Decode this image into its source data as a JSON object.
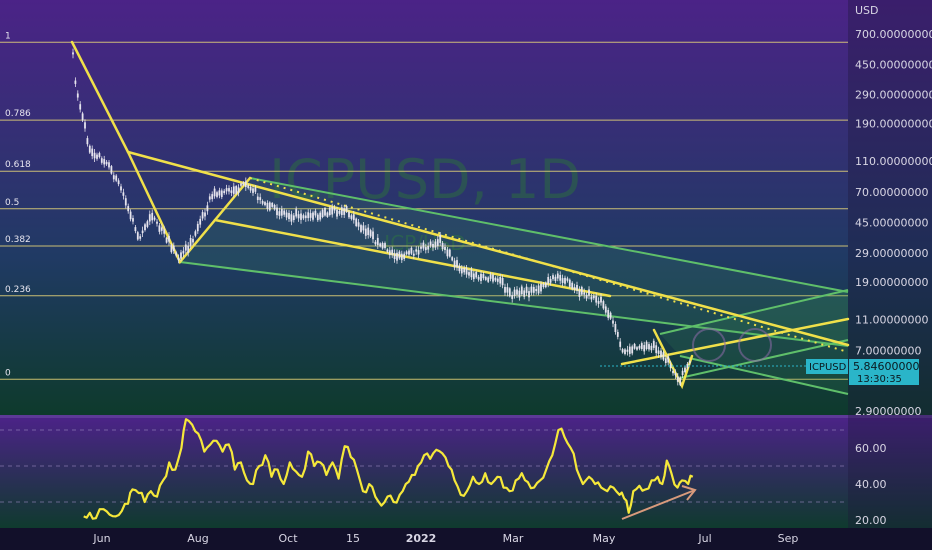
{
  "chart_data": {
    "type": "line",
    "symbol": "ICPUSD",
    "interval": "1D",
    "watermark_main": "ICPUSD, 1D",
    "watermark_sub": "ICP/USD",
    "currency_label": "USD",
    "price_axis": {
      "scale": "log",
      "ticks": [
        {
          "value": 700,
          "label": "700.00000000"
        },
        {
          "value": 450,
          "label": "450.00000000"
        },
        {
          "value": 290,
          "label": "290.00000000"
        },
        {
          "value": 190,
          "label": "190.00000000"
        },
        {
          "value": 110,
          "label": "110.00000000"
        },
        {
          "value": 70,
          "label": "70.00000000"
        },
        {
          "value": 45,
          "label": "45.00000000"
        },
        {
          "value": 29,
          "label": "29.00000000"
        },
        {
          "value": 19,
          "label": "19.00000000"
        },
        {
          "value": 11,
          "label": "11.00000000"
        },
        {
          "value": 7,
          "label": "7.00000000"
        },
        {
          "value": 2.9,
          "label": "2.90000000"
        }
      ]
    },
    "time_axis": [
      "Jun",
      "Aug",
      "Oct",
      "15",
      "2022",
      "Mar",
      "May",
      "Jul",
      "Sep"
    ],
    "fib_levels": [
      {
        "label": "1",
        "price": 620
      },
      {
        "label": "0.786",
        "price": 200
      },
      {
        "label": "0.618",
        "price": 95
      },
      {
        "label": "0.5",
        "price": 55
      },
      {
        "label": "0.382",
        "price": 32
      },
      {
        "label": "0.236",
        "price": 15.5
      },
      {
        "label": "0",
        "price": 4.6
      }
    ],
    "last_price": {
      "symbol": "ICPUSD",
      "value": "5.84600000",
      "countdown": "13:30:35"
    },
    "rsi_axis": {
      "ticks": [
        {
          "value": 60,
          "label": "60.00"
        },
        {
          "value": 40,
          "label": "40.00"
        },
        {
          "value": 20,
          "label": "20.00"
        }
      ],
      "band_upper": 70,
      "band_mid": 50,
      "band_lower": 30
    },
    "rsi_series": [
      {
        "t": "2021-05-20",
        "v": 22
      },
      {
        "t": "2021-05-24",
        "v": 24
      },
      {
        "t": "2021-05-28",
        "v": 21
      },
      {
        "t": "2021-06-02",
        "v": 26
      },
      {
        "t": "2021-06-06",
        "v": 23
      },
      {
        "t": "2021-06-10",
        "v": 22
      },
      {
        "t": "2021-06-14",
        "v": 25
      },
      {
        "t": "2021-06-18",
        "v": 29
      },
      {
        "t": "2021-06-21",
        "v": 37
      },
      {
        "t": "2021-06-25",
        "v": 35
      },
      {
        "t": "2021-06-29",
        "v": 30
      },
      {
        "t": "2021-07-03",
        "v": 36
      },
      {
        "t": "2021-07-07",
        "v": 33
      },
      {
        "t": "2021-07-11",
        "v": 42
      },
      {
        "t": "2021-07-15",
        "v": 52
      },
      {
        "t": "2021-07-19",
        "v": 48
      },
      {
        "t": "2021-07-23",
        "v": 60
      },
      {
        "t": "2021-07-26",
        "v": 76
      },
      {
        "t": "2021-07-30",
        "v": 73
      },
      {
        "t": "2021-08-03",
        "v": 68
      },
      {
        "t": "2021-08-07",
        "v": 58
      },
      {
        "t": "2021-08-11",
        "v": 62
      },
      {
        "t": "2021-08-15",
        "v": 64
      },
      {
        "t": "2021-08-19",
        "v": 58
      },
      {
        "t": "2021-08-23",
        "v": 62
      },
      {
        "t": "2021-08-27",
        "v": 48
      },
      {
        "t": "2021-08-31",
        "v": 52
      },
      {
        "t": "2021-09-04",
        "v": 42
      },
      {
        "t": "2021-09-08",
        "v": 40
      },
      {
        "t": "2021-09-12",
        "v": 50
      },
      {
        "t": "2021-09-16",
        "v": 56
      },
      {
        "t": "2021-09-20",
        "v": 44
      },
      {
        "t": "2021-09-24",
        "v": 48
      },
      {
        "t": "2021-09-28",
        "v": 40
      },
      {
        "t": "2021-10-02",
        "v": 52
      },
      {
        "t": "2021-10-06",
        "v": 47
      },
      {
        "t": "2021-10-10",
        "v": 44
      },
      {
        "t": "2021-10-14",
        "v": 58
      },
      {
        "t": "2021-10-18",
        "v": 50
      },
      {
        "t": "2021-10-22",
        "v": 52
      },
      {
        "t": "2021-10-26",
        "v": 45
      },
      {
        "t": "2021-10-30",
        "v": 52
      },
      {
        "t": "2021-11-03",
        "v": 43
      },
      {
        "t": "2021-11-07",
        "v": 61
      },
      {
        "t": "2021-11-11",
        "v": 55
      },
      {
        "t": "2021-11-15",
        "v": 48
      },
      {
        "t": "2021-11-19",
        "v": 36
      },
      {
        "t": "2021-11-23",
        "v": 40
      },
      {
        "t": "2021-11-27",
        "v": 33
      },
      {
        "t": "2021-12-01",
        "v": 28
      },
      {
        "t": "2021-12-05",
        "v": 33
      },
      {
        "t": "2021-12-09",
        "v": 30
      },
      {
        "t": "2021-12-13",
        "v": 34
      },
      {
        "t": "2021-12-17",
        "v": 40
      },
      {
        "t": "2021-12-21",
        "v": 45
      },
      {
        "t": "2021-12-25",
        "v": 50
      },
      {
        "t": "2021-12-29",
        "v": 56
      },
      {
        "t": "2022-01-02",
        "v": 54
      },
      {
        "t": "2022-01-06",
        "v": 59
      },
      {
        "t": "2022-01-10",
        "v": 57
      },
      {
        "t": "2022-01-14",
        "v": 50
      },
      {
        "t": "2022-01-18",
        "v": 42
      },
      {
        "t": "2022-01-22",
        "v": 34
      },
      {
        "t": "2022-01-26",
        "v": 36
      },
      {
        "t": "2022-01-30",
        "v": 44
      },
      {
        "t": "2022-02-03",
        "v": 40
      },
      {
        "t": "2022-02-07",
        "v": 46
      },
      {
        "t": "2022-02-11",
        "v": 40
      },
      {
        "t": "2022-02-15",
        "v": 44
      },
      {
        "t": "2022-02-19",
        "v": 38
      },
      {
        "t": "2022-02-23",
        "v": 36
      },
      {
        "t": "2022-02-27",
        "v": 42
      },
      {
        "t": "2022-03-03",
        "v": 46
      },
      {
        "t": "2022-03-07",
        "v": 41
      },
      {
        "t": "2022-03-11",
        "v": 38
      },
      {
        "t": "2022-03-15",
        "v": 42
      },
      {
        "t": "2022-03-19",
        "v": 48
      },
      {
        "t": "2022-03-23",
        "v": 56
      },
      {
        "t": "2022-03-27",
        "v": 70
      },
      {
        "t": "2022-03-31",
        "v": 66
      },
      {
        "t": "2022-04-04",
        "v": 60
      },
      {
        "t": "2022-04-08",
        "v": 48
      },
      {
        "t": "2022-04-12",
        "v": 40
      },
      {
        "t": "2022-04-16",
        "v": 44
      },
      {
        "t": "2022-04-20",
        "v": 40
      },
      {
        "t": "2022-04-24",
        "v": 38
      },
      {
        "t": "2022-04-28",
        "v": 36
      },
      {
        "t": "2022-05-02",
        "v": 38
      },
      {
        "t": "2022-05-06",
        "v": 34
      },
      {
        "t": "2022-05-09",
        "v": 32
      },
      {
        "t": "2022-05-12",
        "v": 24
      },
      {
        "t": "2022-05-15",
        "v": 36
      },
      {
        "t": "2022-05-19",
        "v": 39
      },
      {
        "t": "2022-05-23",
        "v": 37
      },
      {
        "t": "2022-05-27",
        "v": 42
      },
      {
        "t": "2022-05-31",
        "v": 44
      },
      {
        "t": "2022-06-03",
        "v": 40
      },
      {
        "t": "2022-06-06",
        "v": 53
      },
      {
        "t": "2022-06-09",
        "v": 46
      },
      {
        "t": "2022-06-13",
        "v": 38
      },
      {
        "t": "2022-06-16",
        "v": 42
      },
      {
        "t": "2022-06-20",
        "v": 40
      },
      {
        "t": "2022-06-23",
        "v": 44
      }
    ],
    "colors": {
      "background_top": "#4b2387",
      "background_bottom": "#0e3a2c",
      "candle": "#e6e4ee",
      "rsi_line": "#f5e83a",
      "drawing_yellow": "#f0e04a",
      "channel_green": "#5fbf6a",
      "fib_line": "#e8d678",
      "arrow": "#d89a7c",
      "price_badge": "#2ab5c9"
    }
  }
}
